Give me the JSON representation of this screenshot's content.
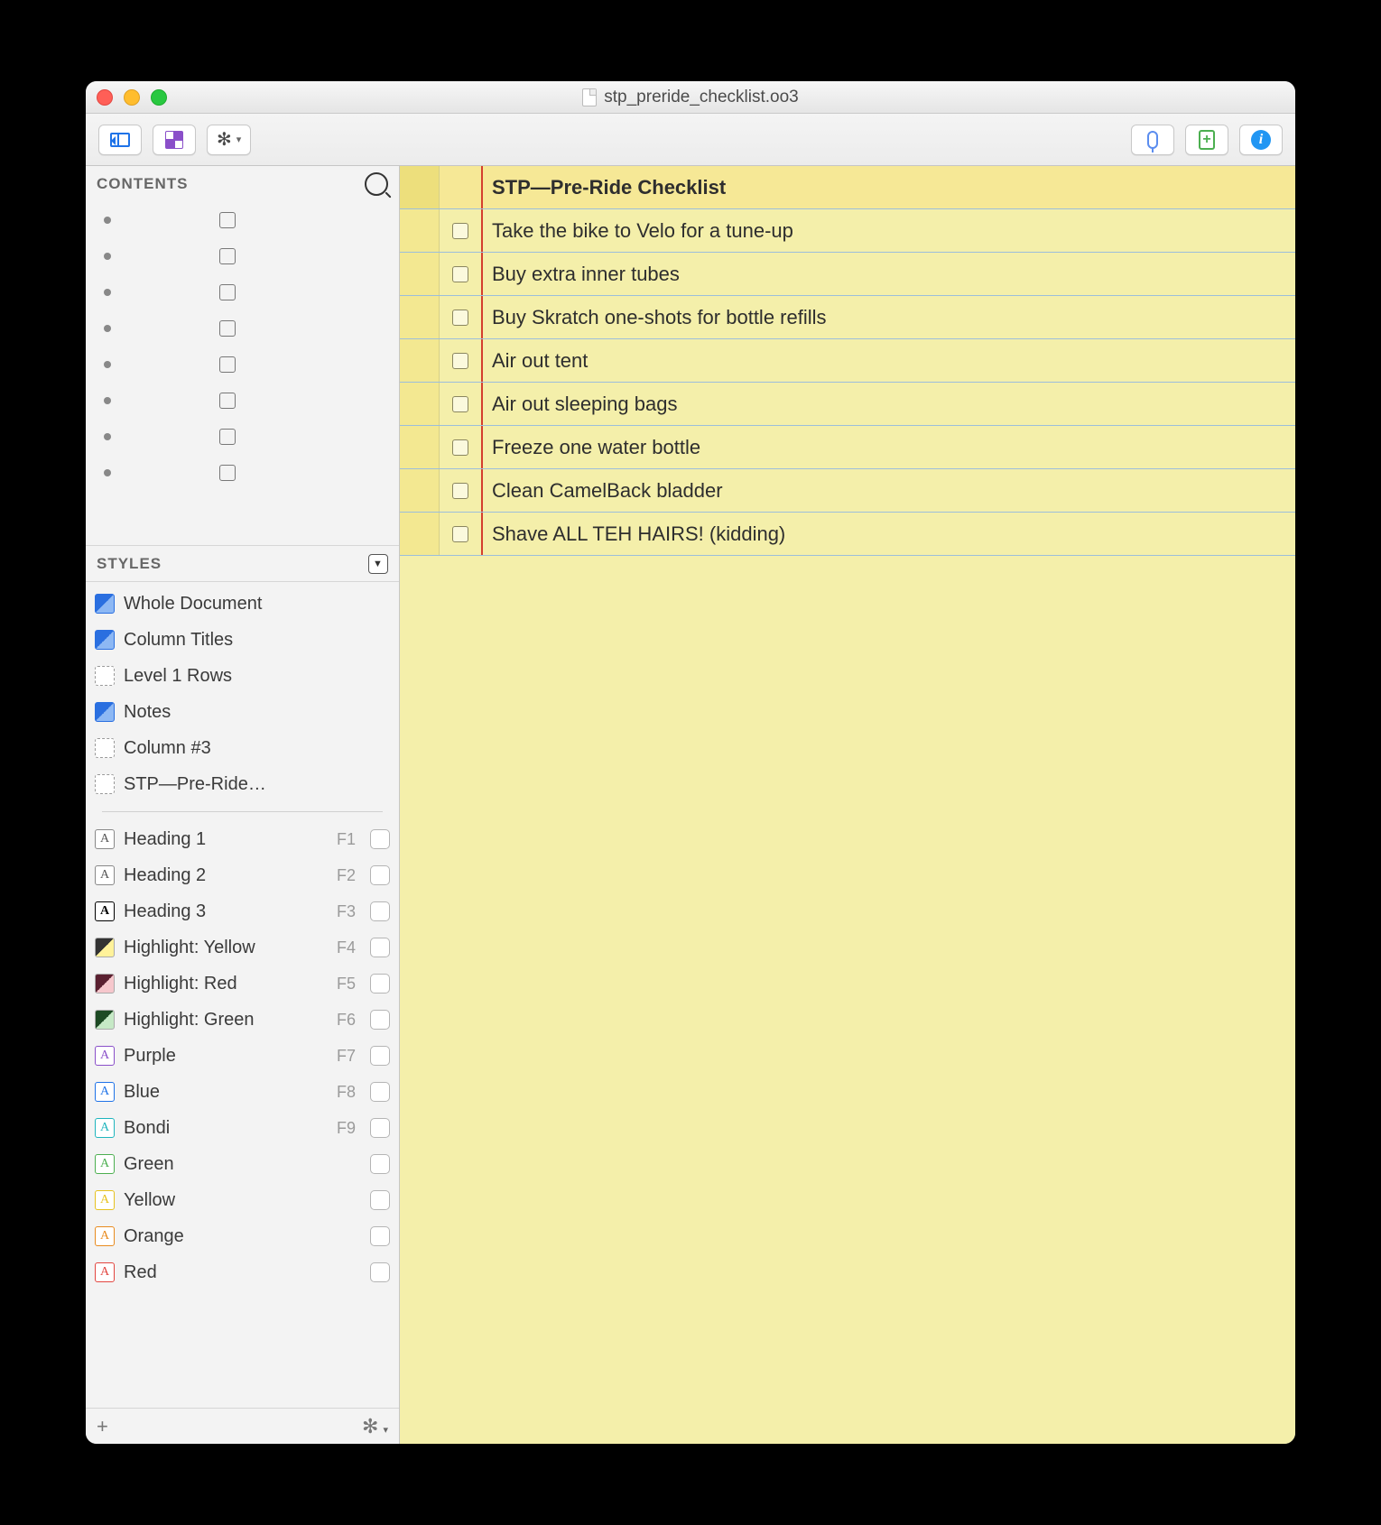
{
  "window": {
    "title": "stp_preride_checklist.oo3"
  },
  "sidebar": {
    "contents_heading": "CONTENTS",
    "styles_heading": "STYLES",
    "contents_rows": [
      {
        "checked": false
      },
      {
        "checked": false
      },
      {
        "checked": false
      },
      {
        "checked": false
      },
      {
        "checked": false
      },
      {
        "checked": false
      },
      {
        "checked": false
      },
      {
        "checked": false
      }
    ],
    "structural_styles": [
      {
        "label": "Whole Document",
        "swatch": "blue"
      },
      {
        "label": "Column Titles",
        "swatch": "blue"
      },
      {
        "label": "Level 1 Rows",
        "swatch": "dashed"
      },
      {
        "label": "Notes",
        "swatch": "blue"
      },
      {
        "label": "Column #3",
        "swatch": "dashed"
      },
      {
        "label": "STP—Pre-Ride…",
        "swatch": "dashed"
      }
    ],
    "named_styles": [
      {
        "label": "Heading 1",
        "swatch": "text",
        "fkey": "F1"
      },
      {
        "label": "Heading 2",
        "swatch": "text",
        "fkey": "F2"
      },
      {
        "label": "Heading 3",
        "swatch": "text bold",
        "fkey": "F3"
      },
      {
        "label": "Highlight: Yellow",
        "swatch": "hl-y",
        "fkey": "F4"
      },
      {
        "label": "Highlight: Red",
        "swatch": "hl-r",
        "fkey": "F5"
      },
      {
        "label": "Highlight: Green",
        "swatch": "hl-g",
        "fkey": "F6"
      },
      {
        "label": "Purple",
        "swatch": "clr-purple",
        "fkey": "F7"
      },
      {
        "label": "Blue",
        "swatch": "clr-blue",
        "fkey": "F8"
      },
      {
        "label": "Bondi",
        "swatch": "clr-bondi",
        "fkey": "F9"
      },
      {
        "label": "Green",
        "swatch": "clr-green",
        "fkey": ""
      },
      {
        "label": "Yellow",
        "swatch": "clr-yellow",
        "fkey": ""
      },
      {
        "label": "Orange",
        "swatch": "clr-orange",
        "fkey": ""
      },
      {
        "label": "Red",
        "swatch": "clr-red",
        "fkey": ""
      }
    ]
  },
  "outline": {
    "title": "STP—Pre-Ride Checklist",
    "rows": [
      {
        "text": "Take the bike to Velo for a tune-up"
      },
      {
        "text": "Buy extra inner tubes"
      },
      {
        "text": "Buy Skratch one-shots for bottle refills"
      },
      {
        "text": "Air out tent"
      },
      {
        "text": "Air out sleeping bags"
      },
      {
        "text": "Freeze one water bottle"
      },
      {
        "text": "Clean CamelBack bladder"
      },
      {
        "text": "Shave ALL TEH HAIRS! (kidding)"
      }
    ]
  }
}
